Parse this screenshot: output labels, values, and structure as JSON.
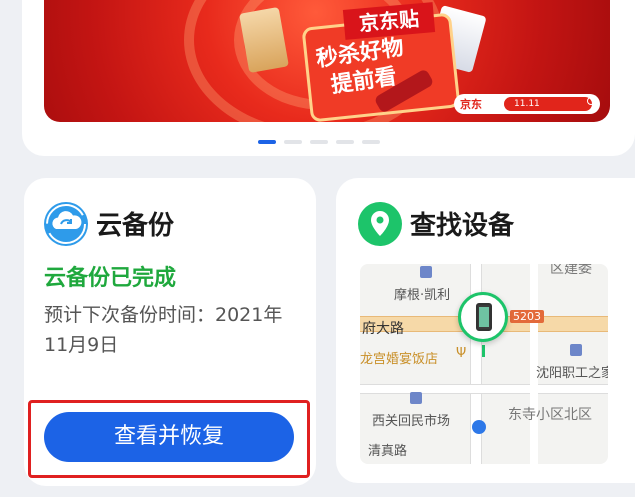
{
  "banner": {
    "promo_top": "京东贴",
    "promo_main": "秒杀好物提前看",
    "jd_logo": "京东",
    "jd_pill": "11.11"
  },
  "carousel": {
    "count": 5,
    "active_index": 0
  },
  "backup_card": {
    "title": "云备份",
    "status": "云备份已完成",
    "next_time": "预计下次备份时间：2021年11月9日",
    "button_label": "查看并恢复"
  },
  "find_card": {
    "title": "查找设备",
    "map": {
      "label_morgan": "摩根·凯利",
      "label_road": "府大路",
      "label_shield": "5203",
      "label_hotel": "龙宫婚宴饭店",
      "label_school": "沈阳职工之家",
      "label_market": "西关回民市场",
      "label_district": "东寺小区北区",
      "label_mosque": "清真路",
      "label_top": "区建委"
    }
  },
  "colors": {
    "accent": "#1c63e6",
    "success": "#1fa83d",
    "highlight": "#e02020",
    "location": "#1dc46a"
  }
}
